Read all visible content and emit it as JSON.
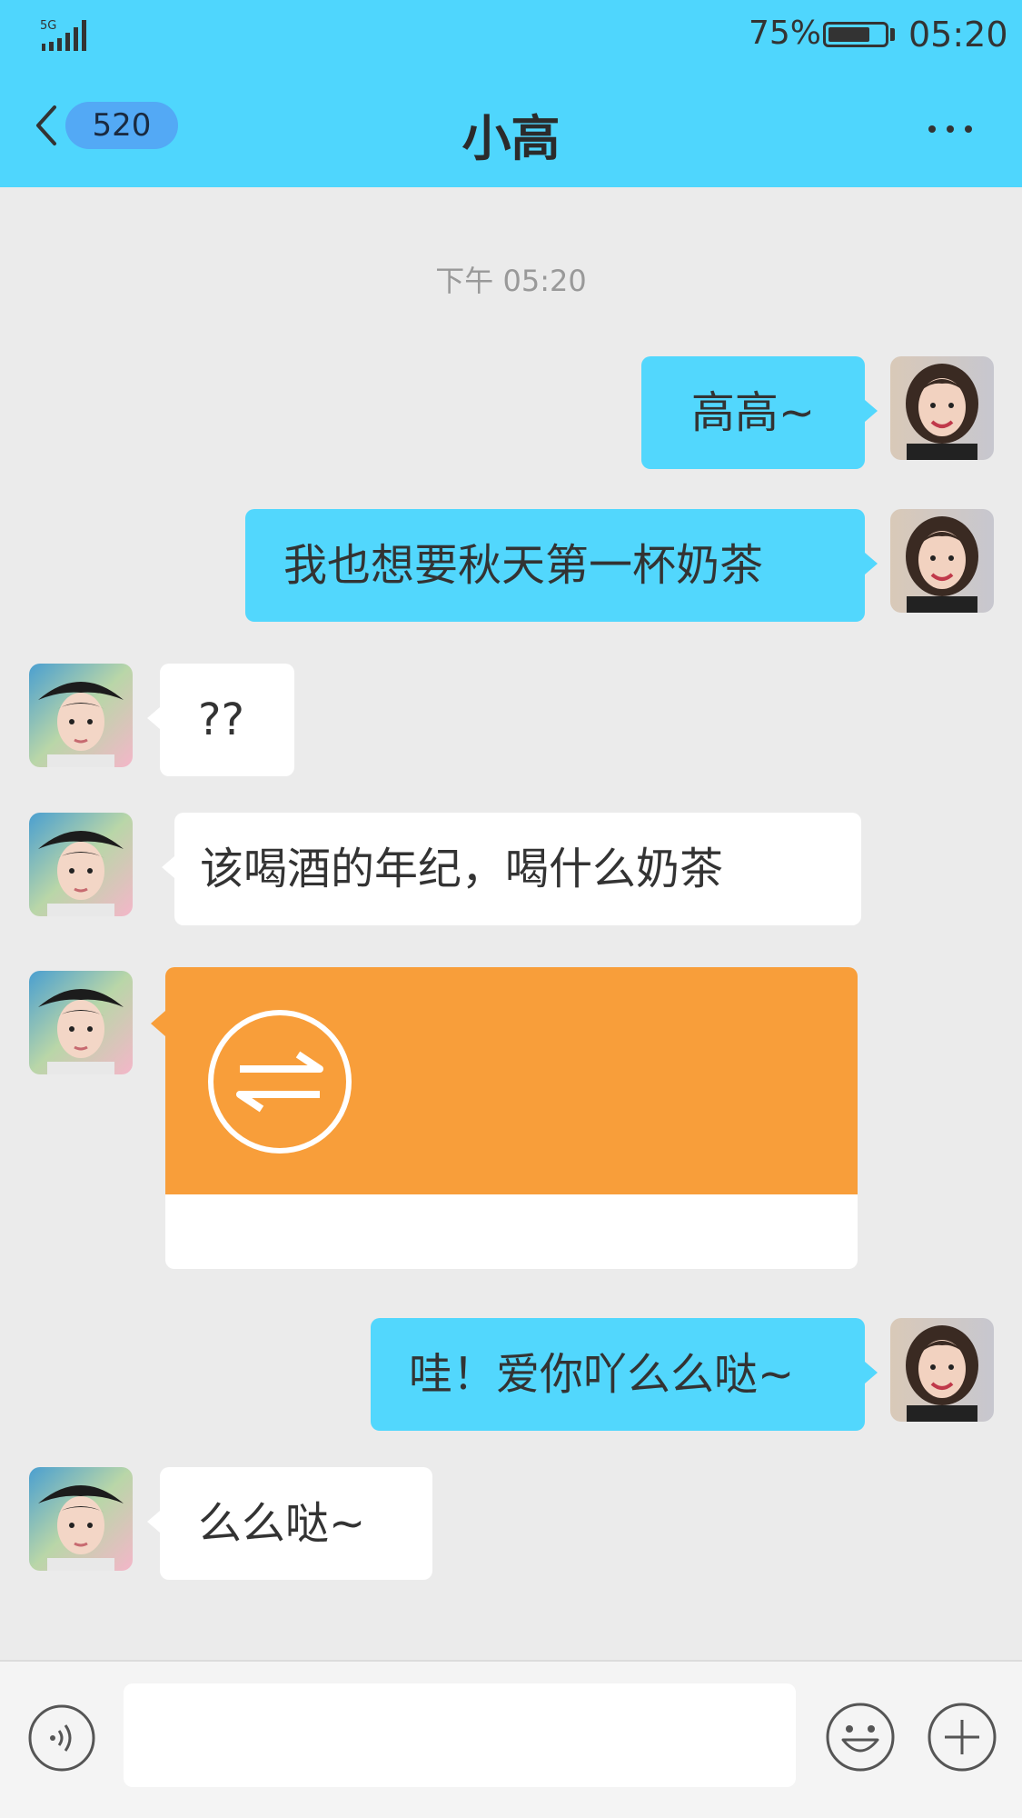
{
  "status_bar": {
    "network": "5G",
    "battery_percent_label": "75%",
    "battery_level": 0.75,
    "time": "05:20"
  },
  "nav": {
    "unread_count": "520",
    "title": "小高",
    "back_icon": "chevron-left-icon",
    "more_icon": "more-dots-icon"
  },
  "chat": {
    "timestamp": "下午 05:20",
    "messages": [
      {
        "sender": "me",
        "text": "高高~"
      },
      {
        "sender": "me",
        "text": "我也想要秋天第一杯奶茶"
      },
      {
        "sender": "friend",
        "text": "??"
      },
      {
        "sender": "friend",
        "text": "该喝酒的年纪，喝什么奶茶"
      },
      {
        "sender": "friend",
        "type": "transfer",
        "icon": "transfer-arrows-icon"
      },
      {
        "sender": "me",
        "text": "哇！爱你吖么么哒~"
      },
      {
        "sender": "friend",
        "text": "么么哒~"
      }
    ]
  },
  "input_bar": {
    "voice_icon": "voice-icon",
    "emoji_icon": "emoji-smile-icon",
    "plus_icon": "plus-icon",
    "input_value": ""
  },
  "colors": {
    "header": "#4fd6fd",
    "outgoing_bubble": "#52d7fd",
    "incoming_bubble": "#ffffff",
    "transfer_card": "#f89e3a",
    "background": "#ebebeb"
  }
}
